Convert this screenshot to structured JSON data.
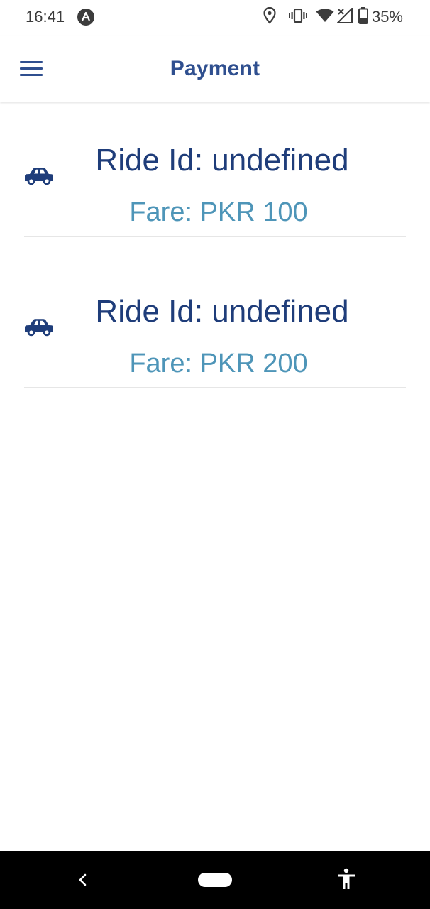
{
  "status_bar": {
    "time": "16:41",
    "battery_percent": "35%",
    "icons": [
      "app-notification-icon",
      "location-icon",
      "vibrate-icon",
      "wifi-icon",
      "signal-icon",
      "battery-icon"
    ]
  },
  "header": {
    "title": "Payment",
    "menu_icon": "hamburger-menu-icon",
    "accent_color": "#2f4f8f"
  },
  "rides": [
    {
      "icon": "car-icon",
      "ride_id": "Ride Id: undefined",
      "fare": "Fare: PKR 100"
    },
    {
      "icon": "car-icon",
      "ride_id": "Ride Id: undefined",
      "fare": "Fare: PKR 200"
    }
  ],
  "colors": {
    "ride_id_text": "#1f3d7a",
    "fare_text": "#4e95b8",
    "divider": "#e6e6e6",
    "nav_bar": "#000000"
  },
  "nav_bar": {
    "back_icon": "back-chevron-icon",
    "home_icon": "home-pill-icon",
    "accessibility_icon": "accessibility-icon"
  }
}
